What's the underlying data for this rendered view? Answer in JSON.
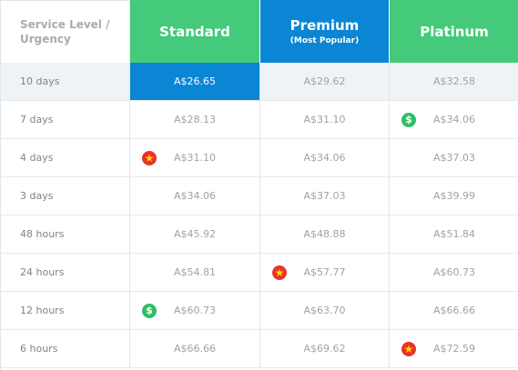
{
  "header": {
    "label": "Service Level / Urgency",
    "columns": [
      {
        "title": "Standard",
        "subtitle": ""
      },
      {
        "title": "Premium",
        "subtitle": "(Most Popular)"
      },
      {
        "title": "Platinum",
        "subtitle": ""
      }
    ]
  },
  "rows": [
    {
      "label": "10 days",
      "prices": [
        "A$26.65",
        "A$29.62",
        "A$32.58"
      ]
    },
    {
      "label": "7 days",
      "prices": [
        "A$28.13",
        "A$31.10",
        "A$34.06"
      ]
    },
    {
      "label": "4 days",
      "prices": [
        "A$31.10",
        "A$34.06",
        "A$37.03"
      ]
    },
    {
      "label": "3 days",
      "prices": [
        "A$34.06",
        "A$37.03",
        "A$39.99"
      ]
    },
    {
      "label": "48 hours",
      "prices": [
        "A$45.92",
        "A$48.88",
        "A$51.84"
      ]
    },
    {
      "label": "24 hours",
      "prices": [
        "A$54.81",
        "A$57.77",
        "A$60.73"
      ]
    },
    {
      "label": "12 hours",
      "prices": [
        "A$60.73",
        "A$63.70",
        "A$66.66"
      ]
    },
    {
      "label": "6 hours",
      "prices": [
        "A$66.66",
        "A$69.62",
        "A$72.59"
      ]
    }
  ],
  "icons": {
    "dollar_glyph": "$",
    "star_glyph": "★",
    "dollar_color": "#2bbf66",
    "star_color": "#e8322b"
  },
  "colors": {
    "green": "#45c97a",
    "blue": "#0a86d4",
    "row_highlight": "#edf3f7"
  }
}
